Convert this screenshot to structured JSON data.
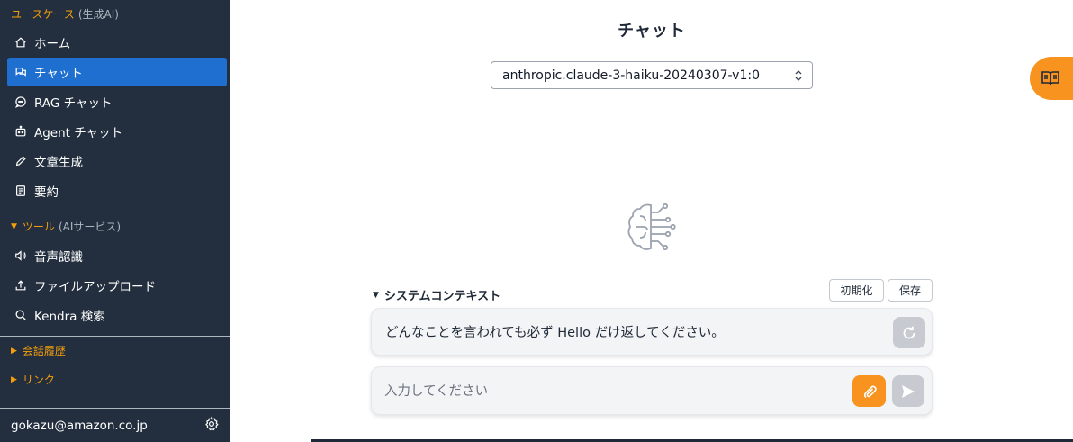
{
  "sidebar": {
    "section_usecase": {
      "label": "ユースケース",
      "sub": "(生成AI)"
    },
    "usecase_items": [
      {
        "label": "ホーム",
        "icon": "home-icon",
        "active": false
      },
      {
        "label": "チャット",
        "icon": "chat-icon",
        "active": true
      },
      {
        "label": "RAG チャット",
        "icon": "rag-chat-icon",
        "active": false
      },
      {
        "label": "Agent チャット",
        "icon": "robot-icon",
        "active": false
      },
      {
        "label": "文章生成",
        "icon": "pencil-icon",
        "active": false
      },
      {
        "label": "要約",
        "icon": "document-icon",
        "active": false
      }
    ],
    "section_tools": {
      "label": "ツール",
      "sub": "(AIサービス)"
    },
    "tool_items": [
      {
        "label": "音声認識",
        "icon": "speaker-icon"
      },
      {
        "label": "ファイルアップロード",
        "icon": "upload-icon"
      },
      {
        "label": "Kendra 検索",
        "icon": "search-icon"
      }
    ],
    "section_history": {
      "label": "会話履歴"
    },
    "section_links": {
      "label": "リンク"
    },
    "user_email": "gokazu@amazon.co.jp"
  },
  "main": {
    "title": "チャット",
    "model_select": {
      "value": "anthropic.claude-3-haiku-20240307-v1:0"
    },
    "system_context": {
      "label": "システムコンテキスト",
      "reset_label": "初期化",
      "save_label": "保存",
      "text": "どんなことを言われても必ず Hello だけ返してください。"
    },
    "chat_input": {
      "placeholder": "入力してください",
      "value": ""
    }
  },
  "colors": {
    "sidebar_bg": "#232f3e",
    "active_item": "#1f6fd0",
    "accent_orange": "#f7931e",
    "section_orange": "#f59e0b",
    "disabled_button": "#c7cad0"
  }
}
